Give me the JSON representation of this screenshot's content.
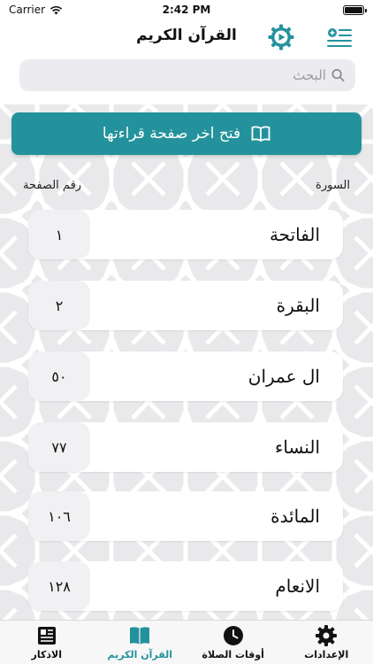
{
  "status": {
    "carrier": "Carrier",
    "time": "2:42 PM"
  },
  "header": {
    "title": "القرآن الكريم",
    "settings_icon": "gear-play-icon",
    "menu_icon": "list-settings-icon"
  },
  "search": {
    "placeholder": "البحث"
  },
  "open_last": {
    "label": "فتح اخر صفحة قراءتها",
    "icon": "open-book-icon"
  },
  "columns": {
    "page": "رقم الصفحة",
    "surah": "السورة"
  },
  "surahs": [
    {
      "name": "الفاتحة",
      "page": "١"
    },
    {
      "name": "البقرة",
      "page": "٢"
    },
    {
      "name": "ال عمران",
      "page": "٥٠"
    },
    {
      "name": "النساء",
      "page": "٧٧"
    },
    {
      "name": "المائدة",
      "page": "١٠٦"
    },
    {
      "name": "الانعام",
      "page": "١٢٨"
    }
  ],
  "tabs": [
    {
      "label": "الاذكار",
      "icon": "newspaper-icon"
    },
    {
      "label": "القرآن الكريم",
      "icon": "book-icon"
    },
    {
      "label": "أوقات الصلاة",
      "icon": "clock-icon"
    },
    {
      "label": "الإعدادات",
      "icon": "gear-icon"
    }
  ],
  "colors": {
    "accent": "#24929c"
  }
}
